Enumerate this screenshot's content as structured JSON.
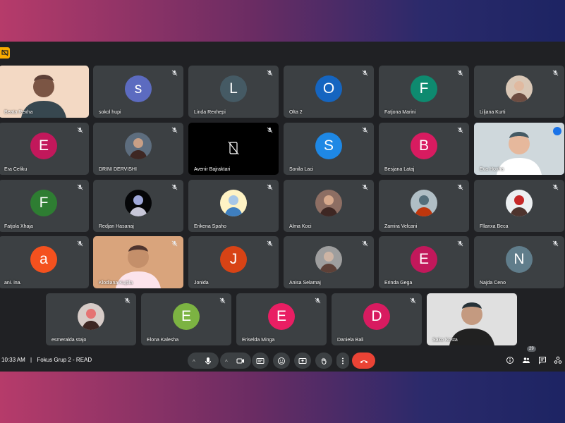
{
  "meeting": {
    "time": "10:33 AM",
    "separator": "|",
    "title": "Fokus Grup 2 - READ"
  },
  "participant_count": "29",
  "participants": [
    {
      "name": "Beata Rexha",
      "type": "video",
      "speaking": false
    },
    {
      "name": "sokol hupi",
      "type": "initial",
      "initial": "s",
      "color": "#5c6bc0"
    },
    {
      "name": "Linda Rexhepi",
      "type": "initial",
      "initial": "L",
      "color": "#455a64"
    },
    {
      "name": "Olta 2",
      "type": "initial",
      "initial": "O",
      "color": "#1565c0"
    },
    {
      "name": "Fatjona Marini",
      "type": "initial",
      "initial": "F",
      "color": "#0e8a6f"
    },
    {
      "name": "Liljana Kurti",
      "type": "photo"
    },
    {
      "name": "Era Celiku",
      "type": "initial",
      "initial": "E",
      "color": "#c2185b"
    },
    {
      "name": "DRINI DERVISHI",
      "type": "photo"
    },
    {
      "name": "Avenir Bajraktari",
      "type": "nocam"
    },
    {
      "name": "Sonila Laci",
      "type": "initial",
      "initial": "S",
      "color": "#1e88e5"
    },
    {
      "name": "Besjana Lataj",
      "type": "initial",
      "initial": "B",
      "color": "#d81b60"
    },
    {
      "name": "Eva Hoxha",
      "type": "video",
      "speaking": true
    },
    {
      "name": "Fatjola Xhaja",
      "type": "initial",
      "initial": "F",
      "color": "#2e7d32"
    },
    {
      "name": "Redjan Hasanaj",
      "type": "photo"
    },
    {
      "name": "Erikena Spaho",
      "type": "photo"
    },
    {
      "name": "Alma Koci",
      "type": "photo"
    },
    {
      "name": "Zamira Velcani",
      "type": "photo"
    },
    {
      "name": "Fllanxa Beca",
      "type": "photo"
    },
    {
      "name": "ani. ina.",
      "type": "initial",
      "initial": "a",
      "color": "#f4511e"
    },
    {
      "name": "Klodiana Kujtila",
      "type": "video"
    },
    {
      "name": "Jonida",
      "type": "initial",
      "initial": "J",
      "color": "#d84315"
    },
    {
      "name": "Anisa Selamaj",
      "type": "photo"
    },
    {
      "name": "Erinda Gega",
      "type": "initial",
      "initial": "E",
      "color": "#c2185b"
    },
    {
      "name": "Najda Ceno",
      "type": "initial",
      "initial": "N",
      "color": "#607d8b"
    },
    {
      "name": "esmeralda stajo",
      "type": "photo"
    },
    {
      "name": "Elona Kalesha",
      "type": "initial",
      "initial": "E",
      "color": "#7cb342"
    },
    {
      "name": "Eriselda Minga",
      "type": "initial",
      "initial": "E",
      "color": "#e91e63"
    },
    {
      "name": "Daniela Bali",
      "type": "initial",
      "initial": "D",
      "color": "#d81b60"
    },
    {
      "name": "Sako Kosta",
      "type": "video"
    }
  ],
  "icons": {
    "mic": "mic-icon",
    "camera": "camera-icon",
    "captions": "captions-icon",
    "emoji": "emoji-icon",
    "present": "present-icon",
    "hand": "raise-hand-icon",
    "more": "more-icon",
    "hangup": "hangup-icon",
    "info": "info-icon",
    "people": "people-icon",
    "chat": "chat-icon",
    "activities": "activities-icon"
  },
  "colors": {
    "background": "#202124",
    "tile": "#3c4043",
    "hangup": "#ea4335",
    "speaking": "#8ab4f8"
  }
}
